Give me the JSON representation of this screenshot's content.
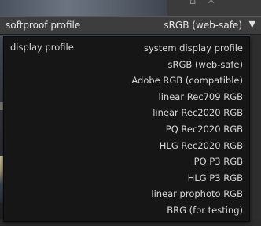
{
  "combo": {
    "label": "softproof profile",
    "value": "sRGB (web-safe)",
    "arrow_icon": "triangle-down-icon"
  },
  "popup": {
    "title": "display profile",
    "options": [
      "system display profile",
      "sRGB (web-safe)",
      "Adobe RGB (compatible)",
      "linear Rec709 RGB",
      "linear Rec2020 RGB",
      "PQ Rec2020 RGB",
      "HLG Rec2020 RGB",
      "PQ P3 RGB",
      "HLG P3 RGB",
      "linear prophoto RGB",
      "BRG (for testing)"
    ]
  },
  "colors": {
    "popup_background": "#161616",
    "header_background": "#3d3d3d",
    "text": "#d8d8d8"
  }
}
